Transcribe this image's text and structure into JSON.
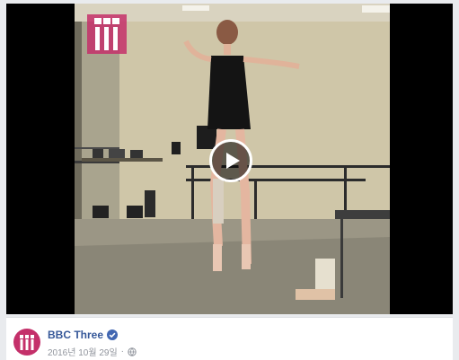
{
  "video": {
    "play_label": "Play video",
    "watermark_text": "BBC III"
  },
  "post": {
    "page_name": "BBC Three",
    "date": "2016년 10월 29일",
    "separator": "·",
    "audience_icon": "globe-icon",
    "verified_icon": "verified-badge-icon"
  },
  "colors": {
    "brand": "#c4306a",
    "link": "#365899",
    "verified": "#4267b2",
    "meta": "#90949c"
  }
}
